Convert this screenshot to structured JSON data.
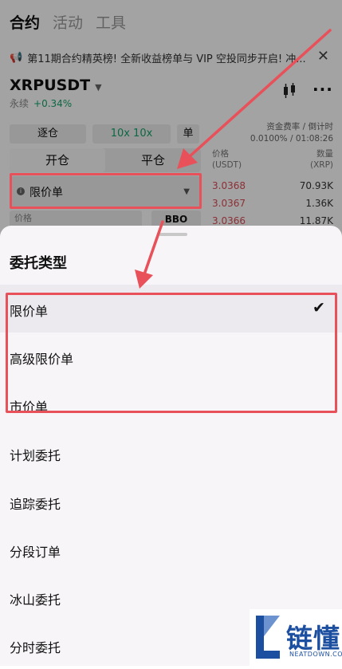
{
  "nav": {
    "tabs": [
      "合约",
      "活动",
      "工具"
    ],
    "active": 0
  },
  "notice": {
    "text": "第11期合约精英榜! 全新收益榜单与 VIP 空投同步开启! 冲..."
  },
  "market": {
    "pair": "XRPUSDT",
    "type": "永续",
    "change": "+0.34%"
  },
  "controls": {
    "margin_mode": "逐仓",
    "leverage": "10x 10x",
    "single": "单",
    "funding_label": "资金费率 / 倒计时",
    "funding_value": "0.0100% / 01:08:26",
    "tab_open": "开仓",
    "tab_close": "平仓",
    "order_type": "限价单",
    "price_placeholder": "价格",
    "bbo": "BBO"
  },
  "orderbook": {
    "price_header": "价格",
    "price_unit": "(USDT)",
    "qty_header": "数量",
    "qty_unit": "(XRP)",
    "rows": [
      {
        "price": "3.0368",
        "qty": "70.93K"
      },
      {
        "price": "3.0367",
        "qty": "1.36K"
      },
      {
        "price": "3.0366",
        "qty": "11.87K"
      }
    ]
  },
  "sheet": {
    "title": "委托类型",
    "options": [
      {
        "label": "限价单",
        "selected": true
      },
      {
        "label": "高级限价单",
        "selected": false
      },
      {
        "label": "市价单",
        "selected": false
      },
      {
        "label": "计划委托",
        "selected": false
      },
      {
        "label": "追踪委托",
        "selected": false
      },
      {
        "label": "分段订单",
        "selected": false
      },
      {
        "label": "冰山委托",
        "selected": false
      },
      {
        "label": "分时委托",
        "selected": false
      }
    ]
  },
  "watermark": {
    "cn": "链懂",
    "en": "NEATDOWN.COM"
  },
  "colors": {
    "annotation": "#e8515a",
    "up": "#16a36b",
    "ask": "#d94c55",
    "brand": "#1c4fa0"
  }
}
